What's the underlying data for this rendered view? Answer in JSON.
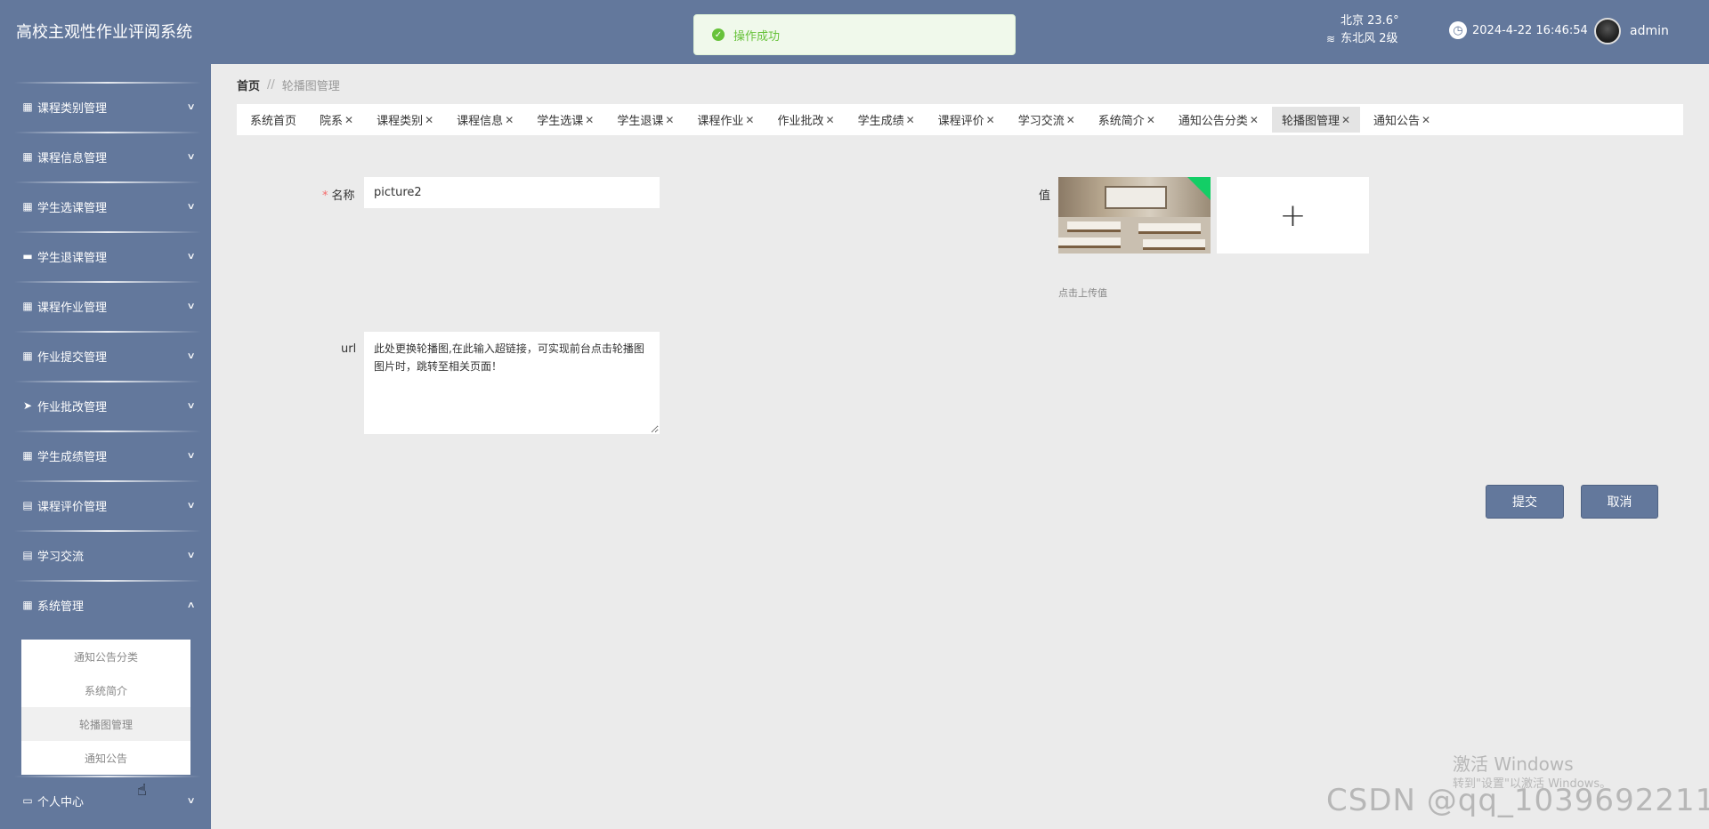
{
  "header": {
    "app_title": "高校主观性作业评阅系统",
    "toast": "操作成功",
    "weather_city_temp": "北京  23.6°",
    "weather_wind": "东北风  2级",
    "datetime": "2024-4-22 16:46:54",
    "username": "admin"
  },
  "sidebar": {
    "items": [
      {
        "label": "课程类别管理",
        "icon": "grid-icon"
      },
      {
        "label": "课程信息管理",
        "icon": "grid-icon"
      },
      {
        "label": "学生选课管理",
        "icon": "grid-icon"
      },
      {
        "label": "学生退课管理",
        "icon": "card-icon"
      },
      {
        "label": "课程作业管理",
        "icon": "grid-icon"
      },
      {
        "label": "作业提交管理",
        "icon": "grid-icon"
      },
      {
        "label": "作业批改管理",
        "icon": "send-icon"
      },
      {
        "label": "学生成绩管理",
        "icon": "grid-icon"
      },
      {
        "label": "课程评价管理",
        "icon": "clipboard-icon"
      },
      {
        "label": "学习交流",
        "icon": "clipboard-icon"
      },
      {
        "label": "系统管理",
        "icon": "grid-icon"
      },
      {
        "label": "个人中心",
        "icon": "id-card-icon"
      }
    ],
    "submenu": [
      "通知公告分类",
      "系统简介",
      "轮播图管理",
      "通知公告"
    ],
    "submenu_active": "轮播图管理"
  },
  "breadcrumb": {
    "home": "首页",
    "separator": "//",
    "current": "轮播图管理"
  },
  "tabs": [
    {
      "label": "系统首页",
      "closable": false
    },
    {
      "label": "院系",
      "closable": true
    },
    {
      "label": "课程类别",
      "closable": true
    },
    {
      "label": "课程信息",
      "closable": true
    },
    {
      "label": "学生选课",
      "closable": true
    },
    {
      "label": "学生退课",
      "closable": true
    },
    {
      "label": "课程作业",
      "closable": true
    },
    {
      "label": "作业批改",
      "closable": true
    },
    {
      "label": "学生成绩",
      "closable": true
    },
    {
      "label": "课程评价",
      "closable": true
    },
    {
      "label": "学习交流",
      "closable": true
    },
    {
      "label": "系统简介",
      "closable": true
    },
    {
      "label": "通知公告分类",
      "closable": true
    },
    {
      "label": "轮播图管理",
      "closable": true,
      "active": true
    },
    {
      "label": "通知公告",
      "closable": true
    }
  ],
  "form": {
    "name_label": "名称",
    "name_required": "*",
    "name_value": "picture2",
    "url_label": "url",
    "url_value": "此处更换轮播图,在此输入超链接，可实现前台点击轮播图图片时，跳转至相关页面！",
    "value_label": "值",
    "upload_plus": "+",
    "upload_hint": "点击上传值",
    "submit_label": "提交",
    "cancel_label": "取消"
  },
  "watermarks": {
    "windows_title": "激活 Windows",
    "windows_sub": "转到\"设置\"以激活 Windows。",
    "csdn": "CSDN @qq_1039692211"
  },
  "colors": {
    "theme": "#63789c",
    "success": "#67c23a",
    "upload_badge": "#13ce66",
    "required": "#f56c6c"
  }
}
